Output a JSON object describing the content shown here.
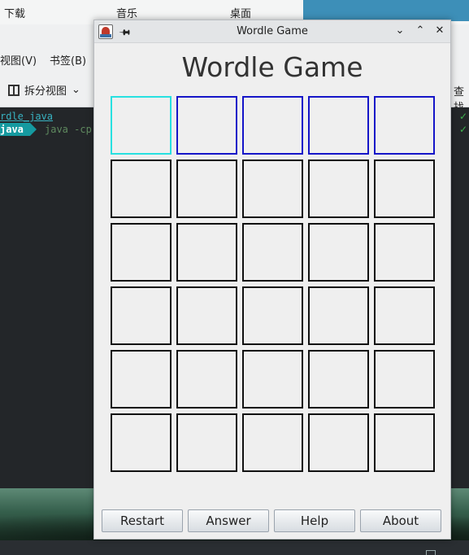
{
  "background": {
    "tabs": [
      "下载",
      "音乐",
      "桌面"
    ],
    "menu": [
      "视图(V)",
      "书签(B)"
    ],
    "toolbar": {
      "split_view": "拆分视图",
      "search": "查找"
    },
    "terminal": {
      "path": "rdle_java",
      "prompt": "java",
      "command": "java -cp",
      "check_mark": "✓"
    }
  },
  "window": {
    "title": "Wordle Game",
    "icons": {
      "app": "java-app-icon",
      "pin": "pin-icon",
      "minimize": "chevron-down-icon",
      "maximize": "chevron-up-icon",
      "close": "close-icon"
    }
  },
  "game": {
    "heading": "Wordle Game",
    "rows": 6,
    "columns": 5,
    "active_row": 0,
    "cursor_column": 0,
    "letters": [
      [
        "",
        "",
        "",
        "",
        ""
      ],
      [
        "",
        "",
        "",
        "",
        ""
      ],
      [
        "",
        "",
        "",
        "",
        ""
      ],
      [
        "",
        "",
        "",
        "",
        ""
      ],
      [
        "",
        "",
        "",
        "",
        ""
      ],
      [
        "",
        "",
        "",
        "",
        ""
      ]
    ],
    "colors": {
      "active_row_border": "#1515c8",
      "cursor_border": "#27e0e0",
      "cell_border": "#111111"
    }
  },
  "buttons": {
    "restart": "Restart",
    "answer": "Answer",
    "help": "Help",
    "about": "About"
  }
}
